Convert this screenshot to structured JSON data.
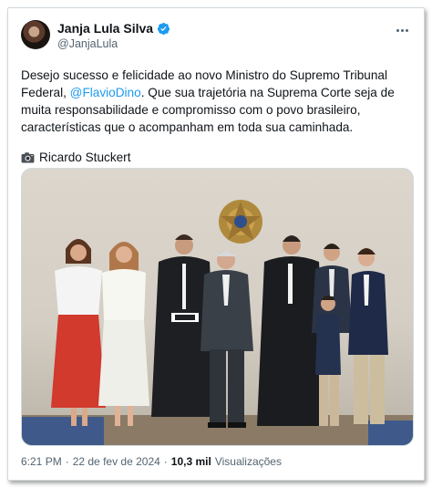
{
  "tweet": {
    "display_name": "Janja Lula Silva",
    "handle": "@JanjaLula",
    "text_before": "Desejo sucesso e felicidade ao novo Ministro do Supremo Tribunal Federal, ",
    "mention": "@FlavioDino",
    "text_after": ". Que sua trajetória na Suprema Corte seja de muita responsabilidade e compromisso com o povo brasileiro, características que o acompanham em toda sua caminhada.",
    "credit": "Ricardo Stuckert",
    "time": "6:21 PM",
    "separator": "·",
    "date": "22 de fev de 2024",
    "views_count": "10,3 mil",
    "views_label": "Visualizações"
  },
  "icons": {
    "verified": "verified-badge-icon",
    "more": "more-options-icon",
    "camera": "camera-icon"
  },
  "colors": {
    "accent": "#1d9bf0",
    "text": "#0f1419",
    "muted": "#536471",
    "border": "#cfd9de"
  }
}
